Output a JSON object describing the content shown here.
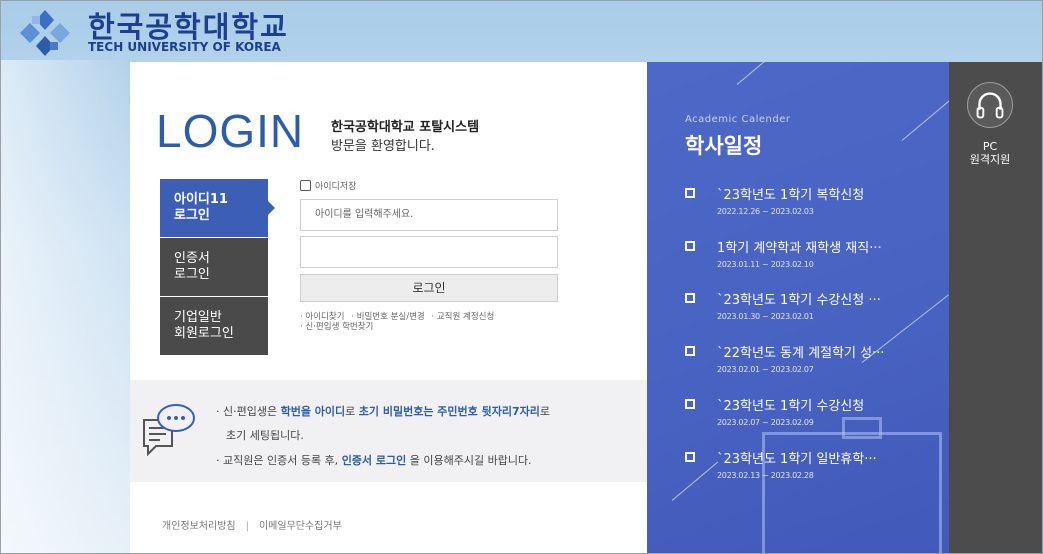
{
  "header": {
    "logo_kr": "한국공학대학교",
    "logo_en": "TECH UNIVERSITY OF KOREA"
  },
  "login": {
    "title": "LOGIN",
    "subtitle_line1": "한국공학대학교 포탈시스템",
    "subtitle_line2": "방문을 환영합니다.",
    "tabs": [
      {
        "line1": "아이디11",
        "line2": "로그인",
        "active": true
      },
      {
        "line1": "인증서",
        "line2": "로그인",
        "active": false
      },
      {
        "line1": "기업일반",
        "line2": "회원로그인",
        "active": false
      }
    ],
    "save_id_label": "아이디저장",
    "id_placeholder": "아이디를 입력해주세요.",
    "password_value": "",
    "login_button": "로그인",
    "links": [
      "· 아이디찾기",
      "· 비밀번호 분실/변경",
      "· 교직원 계정신청"
    ],
    "links2": [
      "· 신·편입생 학번찾기"
    ]
  },
  "notice": {
    "line1_pre": "· 신·편입생은 ",
    "line1_b1": "학번을 아이디",
    "line1_mid": "로 ",
    "line1_b2": "초기 비밀번호는 주민번호 뒷자리7자리",
    "line1_post": "로",
    "line2": "초기 세팅됩니다.",
    "line3_pre": "· 교직원은 인증서 등록 후, ",
    "line3_b": "인증서 로그인",
    "line3_post": " 을 이용해주시길 바랍니다."
  },
  "footer": {
    "privacy": "개인정보처리방침",
    "separator": "|",
    "email_policy": "이메일무단수집거부"
  },
  "calendar": {
    "title_en": "Academic Calender",
    "title_kr": "학사일정",
    "items": [
      {
        "title": "`23학년도 1학기 복학신청",
        "date": "2022.12.26 ~ 2023.02.03"
      },
      {
        "title": "1학기 계약학과 재학생 재직···",
        "date": "2023.01.11 ~ 2023.02.10"
      },
      {
        "title": "`23학년도 1학기 수강신청 ···",
        "date": "2023.01.30 ~ 2023.02.01"
      },
      {
        "title": "`22학년도 동계 계절학기 성···",
        "date": "2023.02.01 ~ 2023.02.07"
      },
      {
        "title": "`23학년도 1학기 수강신청",
        "date": "2023.02.07 ~ 2023.02.09"
      },
      {
        "title": "`23학년도 1학기 일반휴학···",
        "date": "2023.02.13 ~ 2023.02.28"
      }
    ]
  },
  "remote": {
    "line1": "PC",
    "line2": "원격지원",
    "icon": "headphones-icon"
  },
  "colors": {
    "brand": "#1d3f8f",
    "accent": "#3c5fb5",
    "calendar_bg": "#4e68c8",
    "dark_tab": "#4a4a4a"
  }
}
